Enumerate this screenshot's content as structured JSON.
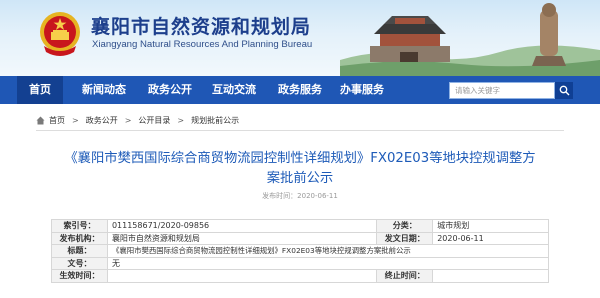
{
  "header": {
    "site_title": "襄阳市自然资源和规划局",
    "site_subtitle": "Xiangyang Natural Resources And Planning Bureau"
  },
  "nav": {
    "items": [
      {
        "label": "首页"
      },
      {
        "label": "新闻动态"
      },
      {
        "label": "政务公开"
      },
      {
        "label": "互动交流"
      },
      {
        "label": "政务服务"
      },
      {
        "label": "办事服务"
      }
    ],
    "search_placeholder": "请输入关键字"
  },
  "breadcrumb": {
    "items": [
      {
        "label": "首页"
      },
      {
        "label": "政务公开"
      },
      {
        "label": "公开目录"
      },
      {
        "label": "规划批前公示"
      }
    ]
  },
  "article": {
    "title": "《襄阳市樊西国际综合商贸物流园控制性详细规划》FX02E03等地块控规调整方案批前公示",
    "date_label": "发布时间：2020-06-11"
  },
  "info_table": {
    "index_label": "索引号：",
    "index_value": "011158671/2020-09856",
    "category_label": "分类：",
    "category_value": "城市规划",
    "publisher_label": "发布机构：",
    "publisher_value": "襄阳市自然资源和规划局",
    "gen_date_label": "发文日期：",
    "gen_date_value": "2020-06-11",
    "subject_label": "标题：",
    "subject_value": "《襄阳市樊西国际综合商贸物流园控制性详细规划》FX02E03等地块控规调整方案批前公示",
    "doc_no_label": "文号：",
    "doc_no_value": "无",
    "effective_label": "生效时间：",
    "effective_value": "",
    "expire_label": "终止时间：",
    "expire_value": ""
  },
  "colors": {
    "nav_blue": "#1f57b5",
    "title_blue": "#1e5bb8",
    "emblem_red": "#c8161d",
    "emblem_gold": "#e6b422"
  },
  "icons": {
    "emblem": "national-emblem-icon",
    "search": "search-icon",
    "home": "home-icon"
  }
}
